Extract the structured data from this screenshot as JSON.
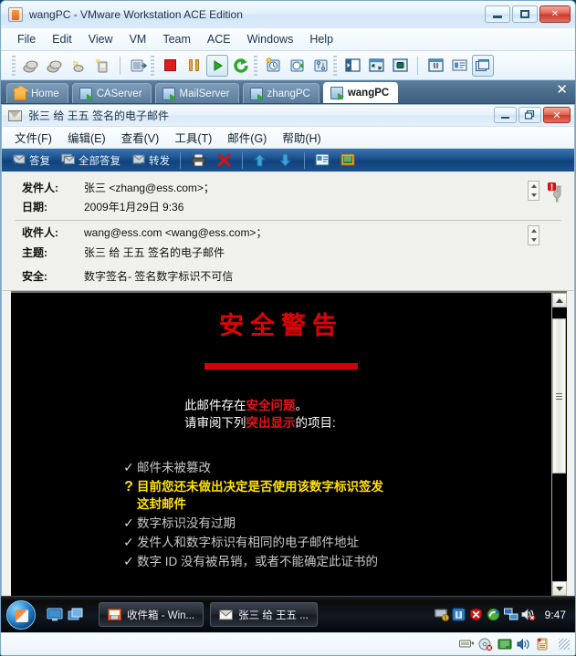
{
  "vmware": {
    "title": "wangPC - VMware Workstation ACE Edition",
    "app_icon": "vmware-icon",
    "window_buttons": [
      {
        "name": "minimize-button",
        "label": ""
      },
      {
        "name": "maximize-button",
        "label": ""
      },
      {
        "name": "close-button",
        "label": "✕"
      }
    ],
    "menu": [
      "File",
      "Edit",
      "View",
      "VM",
      "Team",
      "ACE",
      "Windows",
      "Help"
    ],
    "toolbar_icons": [
      "power-on-snapshot-icon",
      "revert-snapshot-icon",
      "take-snapshot-icon",
      "manage-snapshots-icon",
      "send-ctrl-alt-del-icon",
      "stop-icon",
      "pause-icon",
      "play-icon",
      "reset-icon",
      "snapshot-clock-icon",
      "revert-clock-icon",
      "snapshot-manager-icon",
      "sidebar-toggle-icon",
      "fullscreen-icon",
      "quick-switch-icon",
      "settings-icon",
      "summary-icon",
      "console-view-icon"
    ],
    "tabs": [
      {
        "label": "Home",
        "icon": "home-icon",
        "active": false
      },
      {
        "label": "CAServer",
        "icon": "vm-icon",
        "active": false
      },
      {
        "label": "MailServer",
        "icon": "vm-icon",
        "active": false
      },
      {
        "label": "zhangPC",
        "icon": "vm-icon",
        "active": false
      },
      {
        "label": "wangPC",
        "icon": "vm-icon",
        "active": true
      }
    ],
    "tabstrip_close": "✕",
    "statusbar_icons": [
      "floppy-icon",
      "cdrom-icon",
      "network-icon",
      "sound-icon",
      "usb-icon"
    ]
  },
  "mail_window": {
    "title": "张三 给 王五 签名的电子邮件",
    "icon": "envelope-icon",
    "window_buttons": [
      {
        "name": "minimize-button",
        "label": ""
      },
      {
        "name": "restore-button",
        "label": ""
      },
      {
        "name": "close-button",
        "label": "✕"
      }
    ],
    "menu": [
      "文件(F)",
      "编辑(E)",
      "查看(V)",
      "工具(T)",
      "邮件(G)",
      "帮助(H)"
    ],
    "toolbar": [
      {
        "label": "答复",
        "icon": "reply-icon"
      },
      {
        "label": "全部答复",
        "icon": "reply-all-icon"
      },
      {
        "label": "转发",
        "icon": "forward-icon"
      },
      {
        "label": "",
        "icon": "print-icon"
      },
      {
        "label": "",
        "icon": "delete-icon"
      },
      {
        "label": "",
        "icon": "previous-icon"
      },
      {
        "label": "",
        "icon": "next-icon"
      },
      {
        "label": "",
        "icon": "address-book-icon"
      },
      {
        "label": "",
        "icon": "find-icon"
      }
    ],
    "headers": [
      {
        "label": "发件人:",
        "value": "张三 <zhang@ess.com>；"
      },
      {
        "label": "日期:",
        "value": "2009年1月29日 9:36"
      },
      {
        "label": "收件人:",
        "value": "wang@ess.com <wang@ess.com>；"
      },
      {
        "label": "主题:",
        "value": "张三 给 王五 签名的电子邮件"
      },
      {
        "label": "安全:",
        "value": "数字签名- 签名数字标识不可信"
      }
    ],
    "signature_badge_icon": "signature-warning-icon",
    "body": {
      "title": "安全警告",
      "title_color": "#e00000",
      "rule_color": "#d40000",
      "background": "#000000",
      "intro_lines": [
        [
          {
            "t": "此邮件存在",
            "hl": false
          },
          {
            "t": "安全问题",
            "hl": true
          },
          {
            "t": "。",
            "hl": false
          }
        ],
        [
          {
            "t": "请审阅下列",
            "hl": false
          },
          {
            "t": "突出显示",
            "hl": true
          },
          {
            "t": "的项目:",
            "hl": false
          }
        ]
      ],
      "items": [
        {
          "mark": "✓",
          "status": "ok",
          "text": "邮件未被篡改"
        },
        {
          "mark": "?",
          "status": "question",
          "text": "目前您还未做出决定是否使用该数字标识签发\n这封邮件"
        },
        {
          "mark": "✓",
          "status": "ok",
          "text": "数字标识没有过期"
        },
        {
          "mark": "✓",
          "status": "ok",
          "text": "发件人和数字标识有相同的电子邮件地址"
        },
        {
          "mark": "✓",
          "status": "ok",
          "text": "数字 ID 没有被吊销，或者不能确定此证书的"
        }
      ],
      "ok_color": "#c9c9c9",
      "question_color": "#ffe000",
      "highlight_color": "#e61515"
    },
    "scrollbar": {
      "up": "▲",
      "down": "▼"
    }
  },
  "taskbar": {
    "start_icon": "windows-start-orb",
    "quick_launch": [
      "show-desktop-icon",
      "switch-windows-icon"
    ],
    "items": [
      {
        "label": "收件箱 - Win...",
        "icon": "outlook-express-icon",
        "active": false
      },
      {
        "label": "张三 给 王五 ...",
        "icon": "envelope-icon",
        "active": true
      }
    ],
    "tray_icons": [
      "keyboard-layout-icon",
      "vmware-tools-icon",
      "security-alert-icon",
      "windows-messenger-icon",
      "network-icon",
      "volume-muted-icon"
    ],
    "clock": "9:47"
  }
}
